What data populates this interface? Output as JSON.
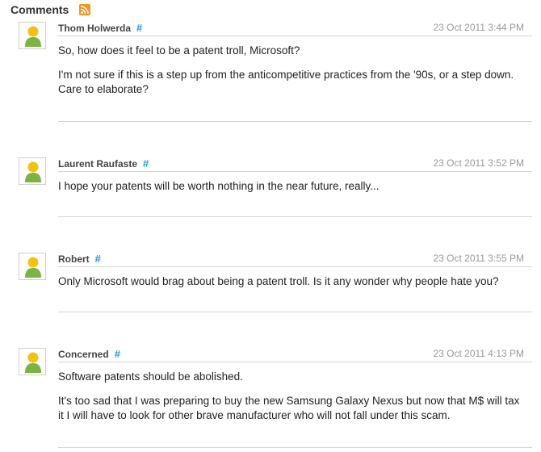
{
  "header": {
    "title": "Comments",
    "rss_icon": "rss-feed-icon"
  },
  "colors": {
    "permalink": "#1a9ad6",
    "rss": "#f7941d",
    "avatar_head": "#f4c20d",
    "avatar_body": "#7cb342"
  },
  "comments": [
    {
      "author": "Thom Holwerda",
      "permalink": "#",
      "timestamp": "23 Oct 2011 3:44 PM",
      "paragraphs": [
        "So, how does it feel to be a patent troll, Microsoft?",
        "I'm not sure if this is a step up from the anticompetitive practices from the '90s, or a step down. Care to elaborate?"
      ]
    },
    {
      "author": "Laurent Raufaste",
      "permalink": "#",
      "timestamp": "23 Oct 2011 3:52 PM",
      "paragraphs": [
        "I hope your patents will be worth nothing in the near future, really..."
      ]
    },
    {
      "author": "Robert",
      "permalink": "#",
      "timestamp": "23 Oct 2011 3:55 PM",
      "paragraphs": [
        "Only Microsoft would brag about being a patent troll. Is it any wonder why people hate you?"
      ]
    },
    {
      "author": "Concerned",
      "permalink": "#",
      "timestamp": "23 Oct 2011 4:13 PM",
      "paragraphs": [
        "Software patents should be abolished.",
        "It's too sad that I was preparing to buy the new Samsung Galaxy Nexus but now that M$ will tax it I will have to look for other brave manufacturer who will not fall under this scam."
      ]
    }
  ]
}
